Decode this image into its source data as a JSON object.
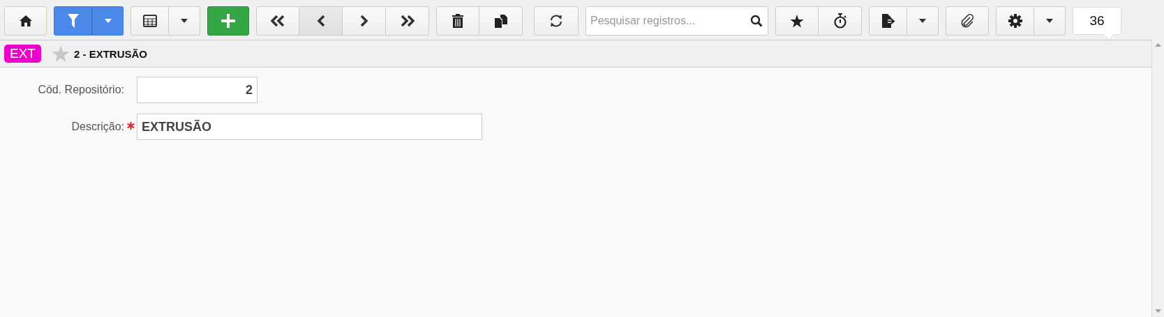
{
  "toolbar": {
    "filter": {
      "active": true
    },
    "search": {
      "placeholder": "Pesquisar registros..."
    },
    "counter": "36"
  },
  "record": {
    "tag": "EXT",
    "favorite": false,
    "title": "2 - EXTRUSÃO"
  },
  "fields": [
    {
      "kind": "number",
      "label": "Cód. Repositório:",
      "required": false,
      "value": "2"
    },
    {
      "kind": "text",
      "label": "Descrição:",
      "required": true,
      "value": "EXTRUSÃO"
    }
  ]
}
